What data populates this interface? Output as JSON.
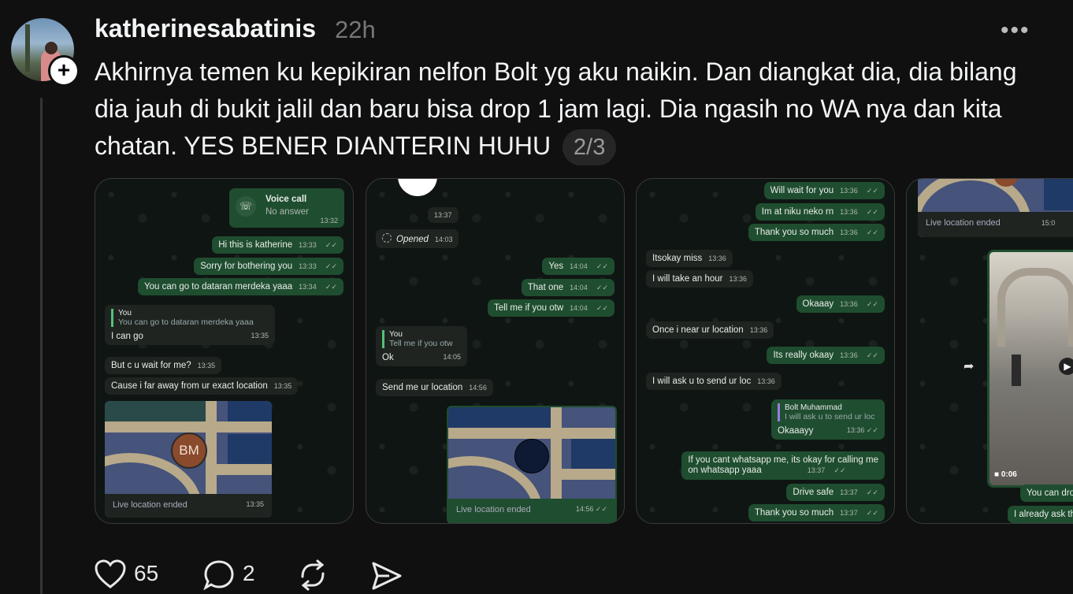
{
  "post": {
    "username": "katherinesabatinis",
    "time": "22h",
    "more_label": "•••",
    "text": "Akhirnya temen ku kepikiran nelfon Bolt yg aku naikin. Dan diangkat dia, dia bilang dia jauh di bukit jalil dan baru bisa drop 1 jam lagi. Dia ngasih no WA nya dan kita chatan. YES BENER DIANTERIN HUHU",
    "pager": "2/3",
    "follow_label": "+"
  },
  "shot1": {
    "voice_title": "Voice call",
    "voice_sub": "No answer",
    "voice_time": "13:32",
    "m1": "Hi this is katherine",
    "m1t": "13:33",
    "m2": "Sorry for bothering you",
    "m2t": "13:33",
    "m3": "You can go to dataran merdeka yaaa",
    "m3t": "13:34",
    "q_name": "You",
    "q_text": "You can go to dataran merdeka yaaa",
    "m4": "I can go",
    "m4t": "13:35",
    "m5": "But c u wait for me?",
    "m5t": "13:35",
    "m6": "Cause i far away from ur exact location",
    "m6t": "13:35",
    "avatar": "BM",
    "map_foot": "Live location ended",
    "map_time": "13:35"
  },
  "shot2": {
    "t0": "13:37",
    "opened": "Opened",
    "opened_t": "14:03",
    "m1": "Yes",
    "m1t": "14:04",
    "m2": "That one",
    "m2t": "14:04",
    "m3": "Tell me if you otw",
    "m3t": "14:04",
    "q_name": "You",
    "q_text": "Tell me if you otw",
    "m4": "Ok",
    "m4t": "14:05",
    "m5": "Send me ur location",
    "m5t": "14:56",
    "map_foot": "Live location ended",
    "map_time": "14:56"
  },
  "shot3": {
    "m1": "Will wait for you",
    "m1t": "13:36",
    "m2": "Im at niku neko rn",
    "m2t": "13:36",
    "m3": "Thank you so much",
    "m3t": "13:36",
    "m4": "Itsokay miss",
    "m4t": "13:36",
    "m5": "I will take an hour",
    "m5t": "13:36",
    "m6": "Okaaay",
    "m6t": "13:36",
    "m7": "Once i near ur location",
    "m7t": "13:36",
    "m8": "Its really okaay",
    "m8t": "13:36",
    "m9": "I will ask u to send ur loc",
    "m9t": "13:36",
    "q_name": "Bolt Muhammad",
    "q_text": "I will ask u to send ur loc",
    "m10": "Okaaayy",
    "m10t": "13:36",
    "m11a": "If you cant whatsapp me, its okay for calling me",
    "m11b": "on whatsapp yaaa",
    "m11t": "13:37",
    "m12": "Drive safe",
    "m12t": "13:37",
    "m13": "Thank you so much",
    "m13t": "13:37"
  },
  "shot4": {
    "map_foot": "Live location ended",
    "map_time": "15:0",
    "video_time": "0:06",
    "m1": "You can dro",
    "m2": "I already ask th"
  },
  "actions": {
    "likes": "65",
    "comments": "2"
  },
  "colors": {
    "background": "#101010",
    "bubble_out": "#1f4d30",
    "bubble_in": "#1f2421"
  }
}
